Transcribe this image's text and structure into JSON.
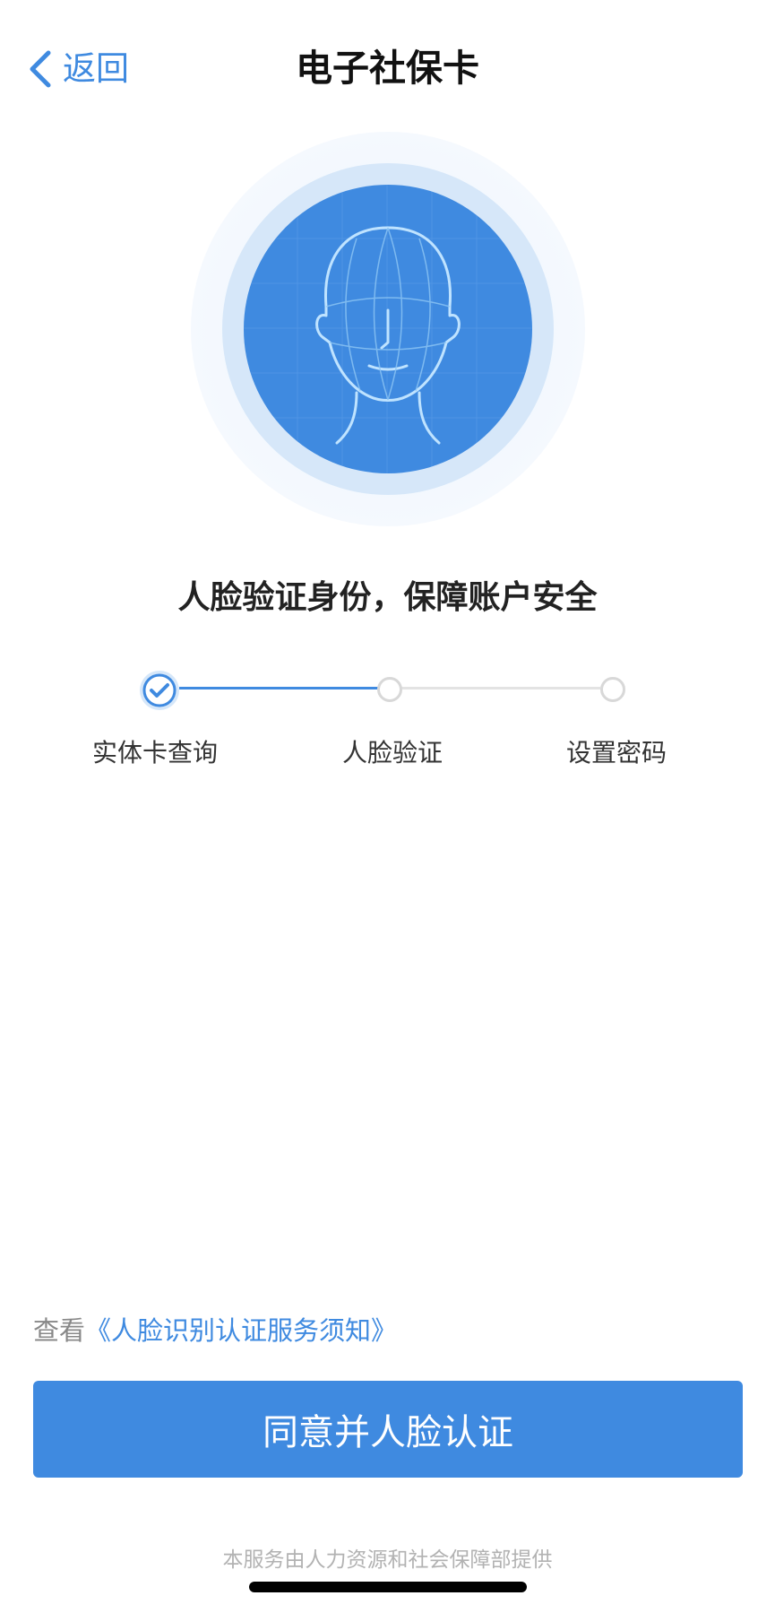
{
  "nav": {
    "back_label": "返回",
    "title": "电子社保卡"
  },
  "hero": {
    "icon": "face-scan-illustration"
  },
  "headline": "人脸验证身份，保障账户安全",
  "steps": [
    {
      "label": "实体卡查询",
      "status": "done"
    },
    {
      "label": "人脸验证",
      "status": "pending"
    },
    {
      "label": "设置密码",
      "status": "pending"
    }
  ],
  "notice": {
    "prefix": "查看",
    "link": "《人脸识别认证服务须知》"
  },
  "primary_button": "同意并人脸认证",
  "footer": "本服务由人力资源和社会保障部提供",
  "colors": {
    "accent": "#3f8ae0",
    "muted": "#888888",
    "track_inactive": "#e3e3e3"
  }
}
